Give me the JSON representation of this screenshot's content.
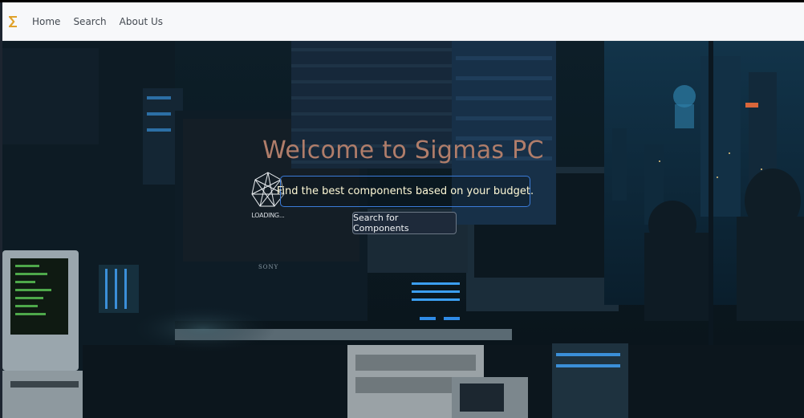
{
  "brand": {
    "logo_glyph": "Σ",
    "logo_color": "#e0a22a"
  },
  "nav": {
    "items": [
      {
        "label": "Home"
      },
      {
        "label": "Search"
      },
      {
        "label": "About Us"
      }
    ]
  },
  "hero": {
    "title": "Welcome to Sigmas PC",
    "tagline": "Find the best components based on your budget.",
    "loader_text": "LOADING...",
    "cta_label": "Search for Components",
    "monitor_brand": "SONY",
    "colors": {
      "title": "#b07d6a",
      "tagline_border": "#3b7bd8",
      "accent_blue": "#2f8be6"
    }
  }
}
